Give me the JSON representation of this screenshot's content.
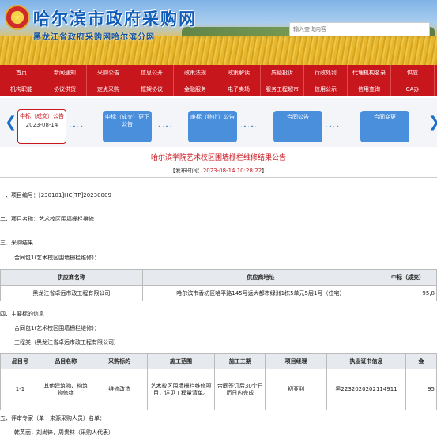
{
  "header": {
    "site_title": "哈尔滨市政府采购网",
    "site_subtitle": "黑龙江省政府采购网哈尔滨分网",
    "emblem_glyph": "★",
    "search_placeholder": "输入查询内容"
  },
  "nav_row1": [
    "首页",
    "新闻通知",
    "采购公告",
    "信息公开",
    "政策法规",
    "政策解读",
    "质疑投诉",
    "行政处罚",
    "代理机构名录",
    "供应"
  ],
  "nav_row2": [
    "机构职能",
    "协议供货",
    "定点采购",
    "框架协议",
    "金融服务",
    "电子卖场",
    "服务工程超市",
    "信用公示",
    "信用查询",
    "CA办"
  ],
  "steps": {
    "prev_arrow": "❮",
    "next_arrow": "❯",
    "dots": "·•·•·",
    "items": [
      {
        "label": "中标（成交）公告",
        "date": "2023-08-14"
      },
      {
        "label": "中标（成交）更正公告"
      },
      {
        "label": "废标（终止）公告"
      },
      {
        "label": "合同公告"
      },
      {
        "label": "合同变更"
      }
    ]
  },
  "notice": {
    "title": "哈尔滨学院艺术校区围墙栅栏维修结果公告",
    "publish_prefix": "【发布时间：",
    "publish_time": "2023-08-14 10:28:22",
    "publish_suffix": "】"
  },
  "sections": {
    "s1_label": "一、项目编号：",
    "s1_value": "[230101]HC[TP]20230009",
    "s2_label": "二、项目名称：",
    "s2_value": "艺术校区围墙栅栏维修",
    "s3_label": "三、采购结果",
    "s3_package": "合同包1(艺术校区围墙栅栏维修)：",
    "s4_label": "四、主要标的信息",
    "s4_package": "合同包1(艺术校区围墙栅栏维修)：",
    "s4_category": "工程类（黑龙江省卓远市政工程有限公司）",
    "s5_label": "五、评审专家（单一来源采购人员）名单：",
    "s5_names": "韩英丽，刘尚锋，周贵林（采购人代表）"
  },
  "table1": {
    "headers": [
      "供应商名称",
      "供应商地址",
      "中标（成交）"
    ],
    "rows": [
      [
        "黑龙江省卓远市政工程有限公司",
        "哈尔滨市香坊区哈平路145号远大都市绿洲1栋5单元5层1号（住宅）",
        "95,8"
      ]
    ]
  },
  "table2": {
    "headers": [
      "品目号",
      "品目名称",
      "采购标的",
      "施工范围",
      "施工工期",
      "项目经理",
      "执业证书信息",
      "金"
    ],
    "rows": [
      [
        "1-1",
        "其他建筑物、构筑物修缮",
        "维修改造",
        "艺术校区围墙栅栏维修项目，详见工程量清单。",
        "合同签订后30个日历日内完成",
        "初亚利",
        "黑2232020202114911",
        "95"
      ]
    ]
  }
}
